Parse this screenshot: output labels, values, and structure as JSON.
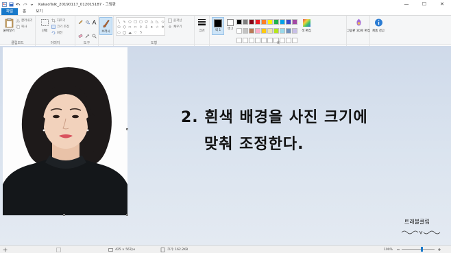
{
  "titlebar": {
    "title": "KakaoTalk_20190117_012015187 - 그림판",
    "minimize": "—",
    "maximize": "☐",
    "close": "✕"
  },
  "menu": {
    "file": "파일",
    "home": "홈",
    "view": "보기"
  },
  "ribbon": {
    "clipboard": {
      "paste": "붙여넣기",
      "cut": "잘라내기",
      "copy": "복사",
      "label": "클립보드"
    },
    "image": {
      "select": "선택",
      "crop": "자르기",
      "resize": "크기 조정",
      "rotate": "회전",
      "label": "이미지"
    },
    "tools": {
      "label": "도구"
    },
    "brushes": {
      "label": "브러시"
    },
    "shapes": {
      "outline": "윤곽선",
      "fill": "채우기",
      "label": "도형"
    },
    "size": {
      "label": "크기"
    },
    "colors": {
      "color1": "색 1",
      "color2": "색 2",
      "edit_colors": "색 편집",
      "paint3d": "그림판 3D로 편집",
      "product_alert": "제품 경고",
      "label": "색"
    }
  },
  "palette_colors": [
    "#000000",
    "#7f7f7f",
    "#880015",
    "#ed1c24",
    "#ff7f27",
    "#fff200",
    "#22b14c",
    "#00a2e8",
    "#3f48cc",
    "#a349a4",
    "#ffffff",
    "#c3c3c3",
    "#b97a57",
    "#ffaec9",
    "#ffc90e",
    "#efe4b0",
    "#b5e61d",
    "#99d9ea",
    "#7092be",
    "#c8bfe7",
    "#ffffff",
    "#ffffff",
    "#ffffff",
    "#ffffff",
    "#ffffff",
    "#ffffff",
    "#ffffff",
    "#ffffff",
    "#ffffff",
    "#ffffff"
  ],
  "canvas": {
    "overlay_line1": "2. 흰색 배경을 사진 크기에",
    "overlay_line2": "맞춰 조정한다.",
    "brand": "트래블클립"
  },
  "status": {
    "dimensions": "425 × 567px",
    "filesize": "크기: 162.2KB",
    "zoom": "100%"
  },
  "colors": {
    "accent": "#1979ca",
    "canvas_bg": "#d4deeb"
  }
}
